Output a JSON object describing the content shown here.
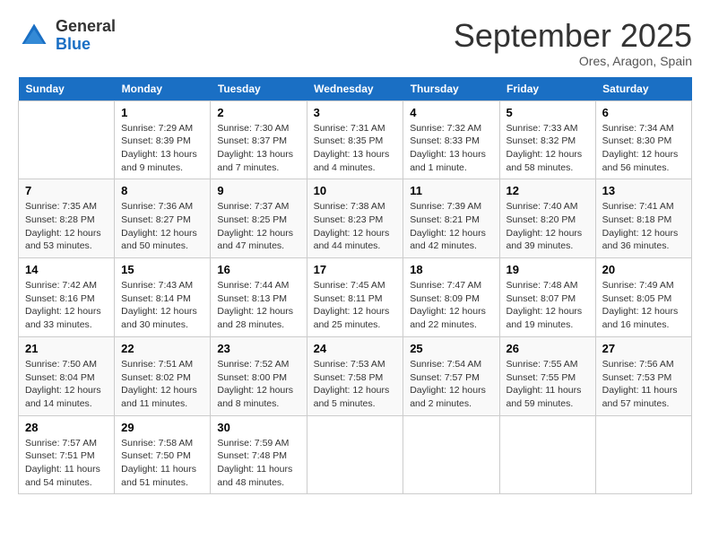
{
  "header": {
    "logo_line1": "General",
    "logo_line2": "Blue",
    "month": "September 2025",
    "location": "Ores, Aragon, Spain"
  },
  "columns": [
    "Sunday",
    "Monday",
    "Tuesday",
    "Wednesday",
    "Thursday",
    "Friday",
    "Saturday"
  ],
  "weeks": [
    [
      {
        "day": "",
        "info": ""
      },
      {
        "day": "1",
        "info": "Sunrise: 7:29 AM\nSunset: 8:39 PM\nDaylight: 13 hours\nand 9 minutes."
      },
      {
        "day": "2",
        "info": "Sunrise: 7:30 AM\nSunset: 8:37 PM\nDaylight: 13 hours\nand 7 minutes."
      },
      {
        "day": "3",
        "info": "Sunrise: 7:31 AM\nSunset: 8:35 PM\nDaylight: 13 hours\nand 4 minutes."
      },
      {
        "day": "4",
        "info": "Sunrise: 7:32 AM\nSunset: 8:33 PM\nDaylight: 13 hours\nand 1 minute."
      },
      {
        "day": "5",
        "info": "Sunrise: 7:33 AM\nSunset: 8:32 PM\nDaylight: 12 hours\nand 58 minutes."
      },
      {
        "day": "6",
        "info": "Sunrise: 7:34 AM\nSunset: 8:30 PM\nDaylight: 12 hours\nand 56 minutes."
      }
    ],
    [
      {
        "day": "7",
        "info": "Sunrise: 7:35 AM\nSunset: 8:28 PM\nDaylight: 12 hours\nand 53 minutes."
      },
      {
        "day": "8",
        "info": "Sunrise: 7:36 AM\nSunset: 8:27 PM\nDaylight: 12 hours\nand 50 minutes."
      },
      {
        "day": "9",
        "info": "Sunrise: 7:37 AM\nSunset: 8:25 PM\nDaylight: 12 hours\nand 47 minutes."
      },
      {
        "day": "10",
        "info": "Sunrise: 7:38 AM\nSunset: 8:23 PM\nDaylight: 12 hours\nand 44 minutes."
      },
      {
        "day": "11",
        "info": "Sunrise: 7:39 AM\nSunset: 8:21 PM\nDaylight: 12 hours\nand 42 minutes."
      },
      {
        "day": "12",
        "info": "Sunrise: 7:40 AM\nSunset: 8:20 PM\nDaylight: 12 hours\nand 39 minutes."
      },
      {
        "day": "13",
        "info": "Sunrise: 7:41 AM\nSunset: 8:18 PM\nDaylight: 12 hours\nand 36 minutes."
      }
    ],
    [
      {
        "day": "14",
        "info": "Sunrise: 7:42 AM\nSunset: 8:16 PM\nDaylight: 12 hours\nand 33 minutes."
      },
      {
        "day": "15",
        "info": "Sunrise: 7:43 AM\nSunset: 8:14 PM\nDaylight: 12 hours\nand 30 minutes."
      },
      {
        "day": "16",
        "info": "Sunrise: 7:44 AM\nSunset: 8:13 PM\nDaylight: 12 hours\nand 28 minutes."
      },
      {
        "day": "17",
        "info": "Sunrise: 7:45 AM\nSunset: 8:11 PM\nDaylight: 12 hours\nand 25 minutes."
      },
      {
        "day": "18",
        "info": "Sunrise: 7:47 AM\nSunset: 8:09 PM\nDaylight: 12 hours\nand 22 minutes."
      },
      {
        "day": "19",
        "info": "Sunrise: 7:48 AM\nSunset: 8:07 PM\nDaylight: 12 hours\nand 19 minutes."
      },
      {
        "day": "20",
        "info": "Sunrise: 7:49 AM\nSunset: 8:05 PM\nDaylight: 12 hours\nand 16 minutes."
      }
    ],
    [
      {
        "day": "21",
        "info": "Sunrise: 7:50 AM\nSunset: 8:04 PM\nDaylight: 12 hours\nand 14 minutes."
      },
      {
        "day": "22",
        "info": "Sunrise: 7:51 AM\nSunset: 8:02 PM\nDaylight: 12 hours\nand 11 minutes."
      },
      {
        "day": "23",
        "info": "Sunrise: 7:52 AM\nSunset: 8:00 PM\nDaylight: 12 hours\nand 8 minutes."
      },
      {
        "day": "24",
        "info": "Sunrise: 7:53 AM\nSunset: 7:58 PM\nDaylight: 12 hours\nand 5 minutes."
      },
      {
        "day": "25",
        "info": "Sunrise: 7:54 AM\nSunset: 7:57 PM\nDaylight: 12 hours\nand 2 minutes."
      },
      {
        "day": "26",
        "info": "Sunrise: 7:55 AM\nSunset: 7:55 PM\nDaylight: 11 hours\nand 59 minutes."
      },
      {
        "day": "27",
        "info": "Sunrise: 7:56 AM\nSunset: 7:53 PM\nDaylight: 11 hours\nand 57 minutes."
      }
    ],
    [
      {
        "day": "28",
        "info": "Sunrise: 7:57 AM\nSunset: 7:51 PM\nDaylight: 11 hours\nand 54 minutes."
      },
      {
        "day": "29",
        "info": "Sunrise: 7:58 AM\nSunset: 7:50 PM\nDaylight: 11 hours\nand 51 minutes."
      },
      {
        "day": "30",
        "info": "Sunrise: 7:59 AM\nSunset: 7:48 PM\nDaylight: 11 hours\nand 48 minutes."
      },
      {
        "day": "",
        "info": ""
      },
      {
        "day": "",
        "info": ""
      },
      {
        "day": "",
        "info": ""
      },
      {
        "day": "",
        "info": ""
      }
    ]
  ]
}
